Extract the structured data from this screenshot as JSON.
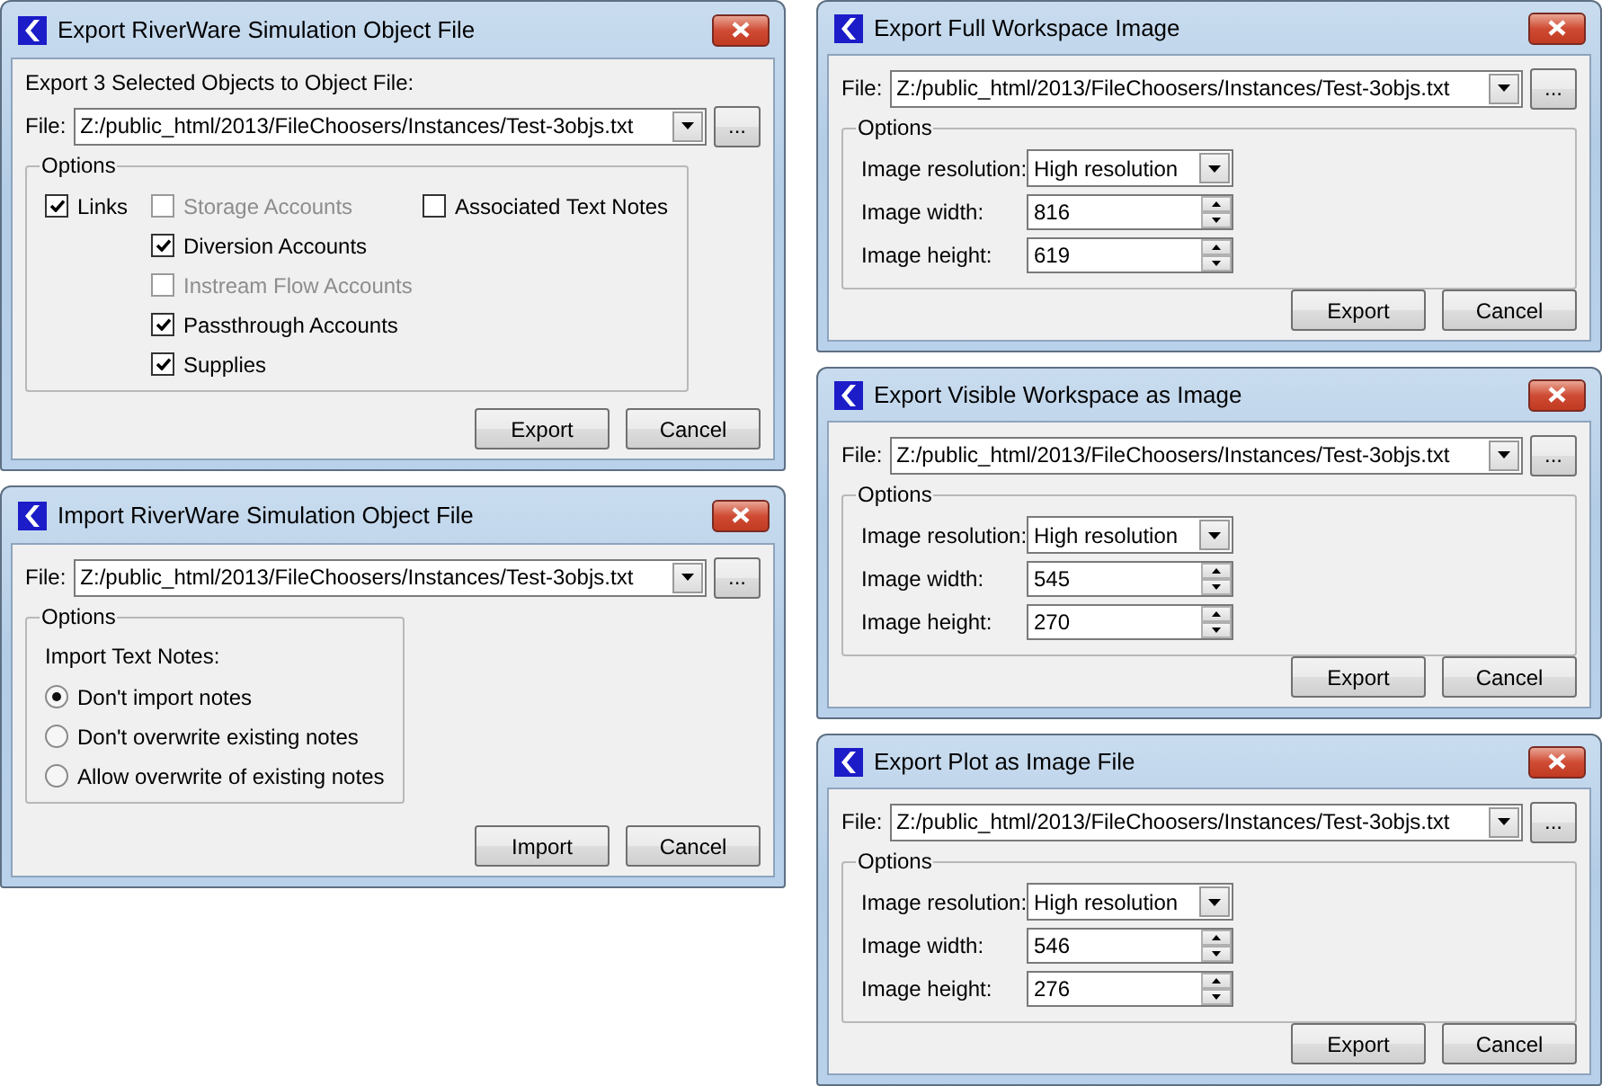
{
  "windows": [
    {
      "title": "Export RiverWare Simulation Object File",
      "heading": "Export 3 Selected Objects to Object File:",
      "file": {
        "label": "File:",
        "value": "Z:/public_html/2013/FileChoosers/Instances/Test-3objs.txt",
        "browse": "..."
      },
      "options": {
        "kind": "checkbox_columns",
        "title": "Options",
        "columns": [
          {
            "checkboxes": [
              {
                "label": "Links",
                "checked": true,
                "disabled": false
              }
            ]
          },
          {
            "checkboxes": [
              {
                "label": "Storage Accounts",
                "checked": false,
                "disabled": true
              },
              {
                "label": "Diversion Accounts",
                "checked": true,
                "disabled": false
              },
              {
                "label": "Instream Flow Accounts",
                "checked": false,
                "disabled": true
              },
              {
                "label": "Passthrough Accounts",
                "checked": true,
                "disabled": false
              },
              {
                "label": "Supplies",
                "checked": true,
                "disabled": false
              }
            ]
          },
          {
            "checkboxes": [
              {
                "label": "Associated Text Notes",
                "checked": false,
                "disabled": false
              }
            ]
          }
        ]
      },
      "buttons": [
        "Export",
        "Cancel"
      ]
    },
    {
      "title": "Import RiverWare Simulation Object File",
      "file": {
        "label": "File:",
        "value": "Z:/public_html/2013/FileChoosers/Instances/Test-3objs.txt",
        "browse": "..."
      },
      "options": {
        "kind": "radio_group",
        "title": "Options",
        "prompt": "Import Text Notes:",
        "radios": [
          {
            "label": "Don't import notes",
            "selected": true
          },
          {
            "label": "Don't overwrite existing notes",
            "selected": false
          },
          {
            "label": "Allow overwrite of existing notes",
            "selected": false
          }
        ]
      },
      "buttons": [
        "Import",
        "Cancel"
      ]
    },
    {
      "title": "Export Full Workspace Image",
      "file": {
        "label": "File:",
        "value": "Z:/public_html/2013/FileChoosers/Instances/Test-3objs.txt",
        "browse": "..."
      },
      "options": {
        "kind": "form",
        "title": "Options",
        "fields": [
          {
            "kind": "dropdown",
            "label": "Image resolution:",
            "value": "High resolution"
          },
          {
            "kind": "spinner",
            "label": "Image width:",
            "value": "816"
          },
          {
            "kind": "spinner",
            "label": "Image height:",
            "value": "619"
          }
        ]
      },
      "buttons": [
        "Export",
        "Cancel"
      ]
    },
    {
      "title": "Export Visible Workspace as Image",
      "file": {
        "label": "File:",
        "value": "Z:/public_html/2013/FileChoosers/Instances/Test-3objs.txt",
        "browse": "..."
      },
      "options": {
        "kind": "form",
        "title": "Options",
        "fields": [
          {
            "kind": "dropdown",
            "label": "Image resolution:",
            "value": "High resolution"
          },
          {
            "kind": "spinner",
            "label": "Image width:",
            "value": "545"
          },
          {
            "kind": "spinner",
            "label": "Image height:",
            "value": "270"
          }
        ]
      },
      "buttons": [
        "Export",
        "Cancel"
      ]
    },
    {
      "title": "Export Plot as Image File",
      "file": {
        "label": "File:",
        "value": "Z:/public_html/2013/FileChoosers/Instances/Test-3objs.txt",
        "browse": "..."
      },
      "options": {
        "kind": "form",
        "title": "Options",
        "fields": [
          {
            "kind": "dropdown",
            "label": "Image resolution:",
            "value": "High resolution"
          },
          {
            "kind": "spinner",
            "label": "Image width:",
            "value": "546"
          },
          {
            "kind": "spinner",
            "label": "Image height:",
            "value": "276"
          }
        ]
      },
      "buttons": [
        "Export",
        "Cancel"
      ]
    }
  ]
}
